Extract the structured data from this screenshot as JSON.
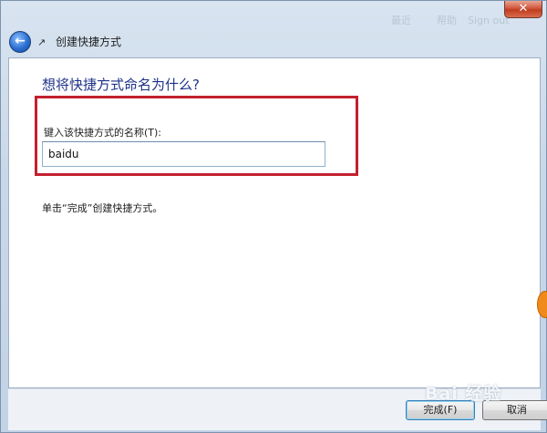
{
  "titlebar": {
    "faded_buttons": [
      "最近",
      "帮助",
      "Sign out"
    ],
    "close_label": "✕"
  },
  "nav": {
    "back_glyph": "←",
    "title_icon": "shortcut-icon",
    "window_title": "创建快捷方式"
  },
  "main": {
    "heading": "想将快捷方式命名为什么?",
    "field_label": "键入该快捷方式的名称(T):",
    "name_value": "baidu",
    "instruction": "单击“完成”创建快捷方式。"
  },
  "footer": {
    "finish_label": "完成(F)",
    "cancel_label": "取消"
  },
  "watermark": "Bai 经验",
  "colors": {
    "heading": "#1e3287",
    "highlight": "#c3202e",
    "back_button": "#2b6fd0"
  }
}
